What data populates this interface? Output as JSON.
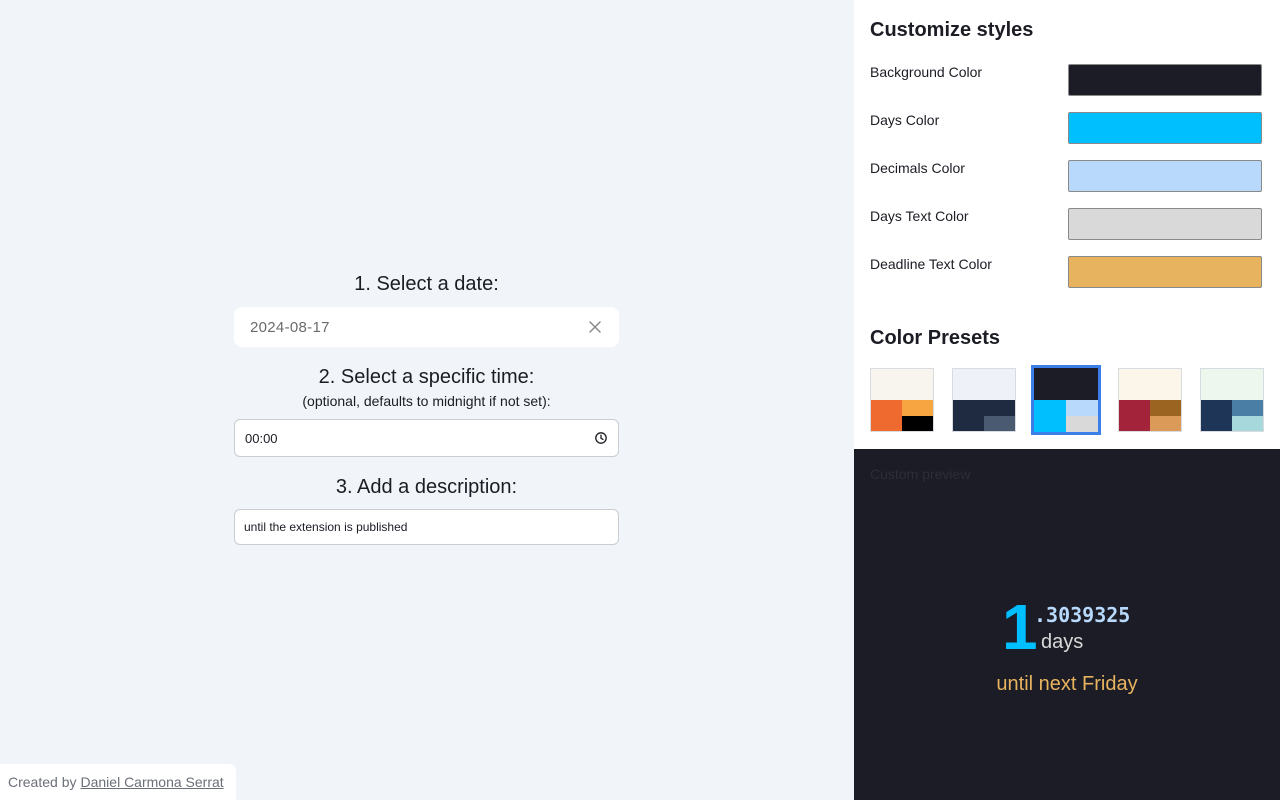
{
  "form": {
    "step1_label": "1. Select a date:",
    "date_value": "2024-08-17",
    "step2_label": "2. Select a specific time:",
    "step2_sub": "(optional, defaults to midnight if not set):",
    "time_value": "00:00",
    "step3_label": "3. Add a description:",
    "description_value": "until the extension is published"
  },
  "credit": {
    "prefix": "Created by",
    "author": "Daniel Carmona Serrat"
  },
  "styles": {
    "title": "Customize styles",
    "rows": [
      {
        "label": "Background Color",
        "color": "#1b1c26"
      },
      {
        "label": "Days Color",
        "color": "#00bfff"
      },
      {
        "label": "Decimals Color",
        "color": "#b8d9fb"
      },
      {
        "label": "Days Text Color",
        "color": "#d9d9d9"
      },
      {
        "label": "Deadline Text Color",
        "color": "#e8b35e"
      }
    ]
  },
  "presets": {
    "title": "Color Presets",
    "selected_index": 2,
    "items": [
      {
        "top": "#f8f4ee",
        "bl": "#ee6a2e",
        "tr": "#f7a541",
        "br": "#000000"
      },
      {
        "top": "#eef2f8",
        "bl": "#1f2b41",
        "tr": "#1f2b41",
        "br": "#4a5a70"
      },
      {
        "top": "#1b1c26",
        "bl": "#00bfff",
        "tr": "#b8d9fb",
        "br": "#d9d9d9"
      },
      {
        "top": "#fbf5ea",
        "bl": "#a3233a",
        "tr": "#9b6420",
        "br": "#dc9a59"
      },
      {
        "top": "#eef7ee",
        "bl": "#1e3558",
        "tr": "#4a7ea4",
        "br": "#a7d8dc"
      }
    ]
  },
  "preview": {
    "caption": "Custom preview",
    "days_number": "1",
    "days_decimals": ".3039325",
    "days_text": "days",
    "deadline_text": "until next Friday"
  }
}
